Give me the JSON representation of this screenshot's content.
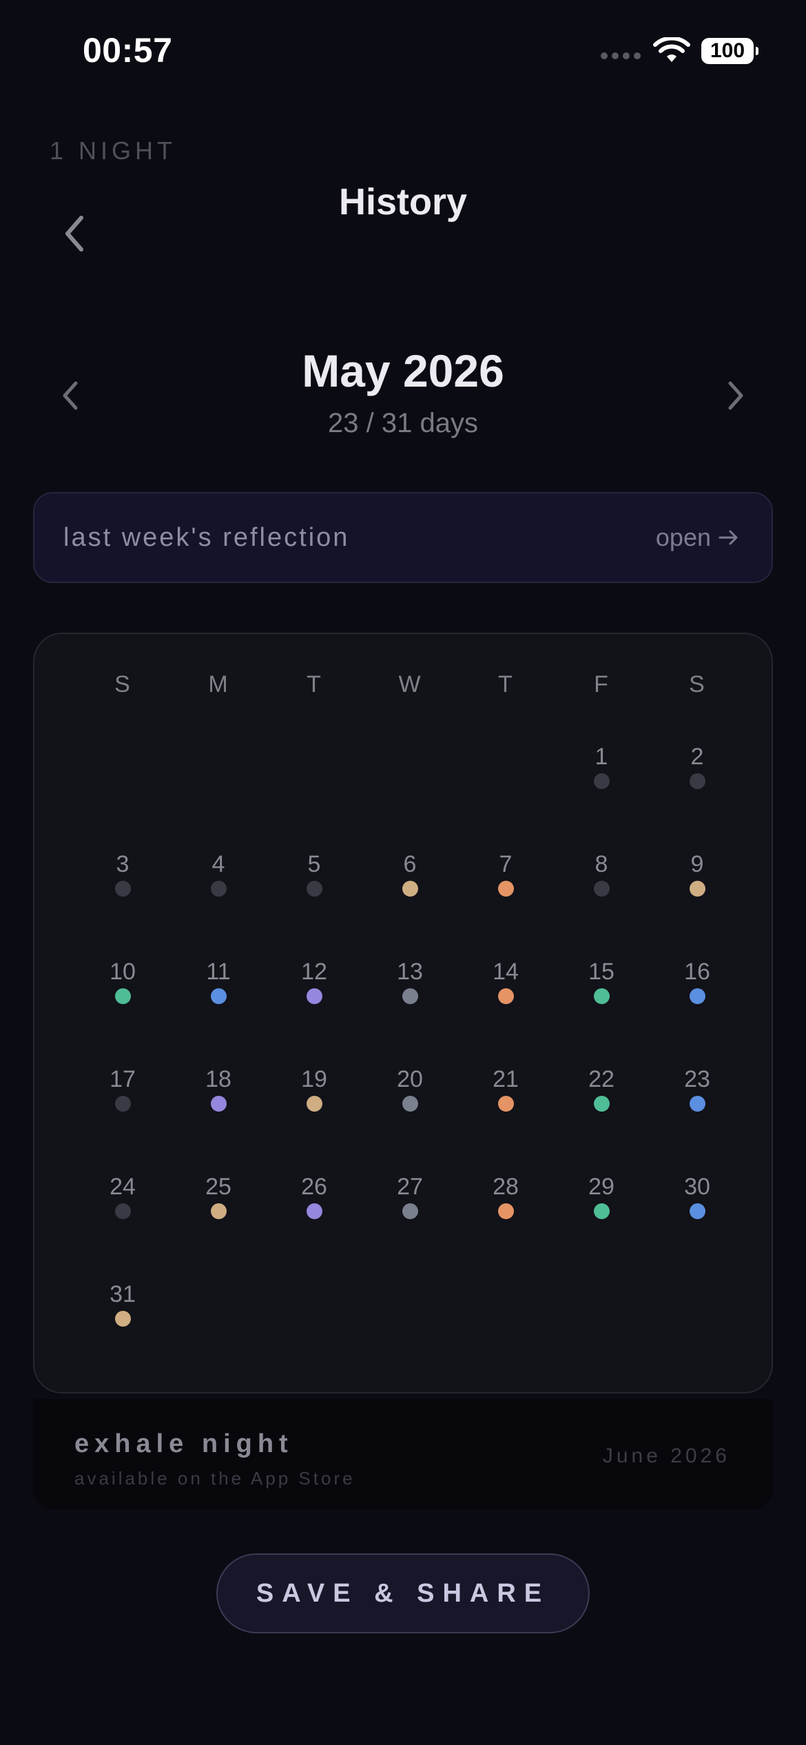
{
  "status_bar": {
    "time": "00:57",
    "battery": "100"
  },
  "header": {
    "night_label": "1 NIGHT",
    "title": "History"
  },
  "month": {
    "title": "May 2026",
    "count": "23 / 31 days"
  },
  "reflection": {
    "label": "last week's reflection",
    "open_label": "open"
  },
  "calendar": {
    "weekdays": [
      "S",
      "M",
      "T",
      "W",
      "T",
      "F",
      "S"
    ],
    "first_weekday_index": 5,
    "days": [
      {
        "day": "1",
        "color": "#3a3a44"
      },
      {
        "day": "2",
        "color": "#3a3a44"
      },
      {
        "day": "3",
        "color": "#3a3a44"
      },
      {
        "day": "4",
        "color": "#3a3a44"
      },
      {
        "day": "5",
        "color": "#3a3a44"
      },
      {
        "day": "6",
        "color": "#cfae83"
      },
      {
        "day": "7",
        "color": "#e59465"
      },
      {
        "day": "8",
        "color": "#3a3a44"
      },
      {
        "day": "9",
        "color": "#cfae83"
      },
      {
        "day": "10",
        "color": "#4fbd95"
      },
      {
        "day": "11",
        "color": "#5b8fe0"
      },
      {
        "day": "12",
        "color": "#9587dd"
      },
      {
        "day": "13",
        "color": "#7a808e"
      },
      {
        "day": "14",
        "color": "#e59465"
      },
      {
        "day": "15",
        "color": "#4fbd95"
      },
      {
        "day": "16",
        "color": "#5b8fe0"
      },
      {
        "day": "17",
        "color": "#3a3a44"
      },
      {
        "day": "18",
        "color": "#9587dd"
      },
      {
        "day": "19",
        "color": "#cfae83"
      },
      {
        "day": "20",
        "color": "#7a808e"
      },
      {
        "day": "21",
        "color": "#e59465"
      },
      {
        "day": "22",
        "color": "#4fbd95"
      },
      {
        "day": "23",
        "color": "#5b8fe0"
      },
      {
        "day": "24",
        "color": "#3a3a44"
      },
      {
        "day": "25",
        "color": "#cfae83"
      },
      {
        "day": "26",
        "color": "#9587dd"
      },
      {
        "day": "27",
        "color": "#7a808e"
      },
      {
        "day": "28",
        "color": "#e59465"
      },
      {
        "day": "29",
        "color": "#4fbd95"
      },
      {
        "day": "30",
        "color": "#5b8fe0"
      },
      {
        "day": "31",
        "color": "#cfae83"
      }
    ]
  },
  "promo": {
    "name": "exhale night",
    "subtitle": "available on the App Store",
    "date": "June 2026"
  },
  "actions": {
    "save_share": "SAVE & SHARE"
  },
  "icons": [
    "back-chevron-icon",
    "chevron-left-icon",
    "chevron-right-icon",
    "arrow-right-icon",
    "wifi-icon",
    "battery-icon"
  ]
}
